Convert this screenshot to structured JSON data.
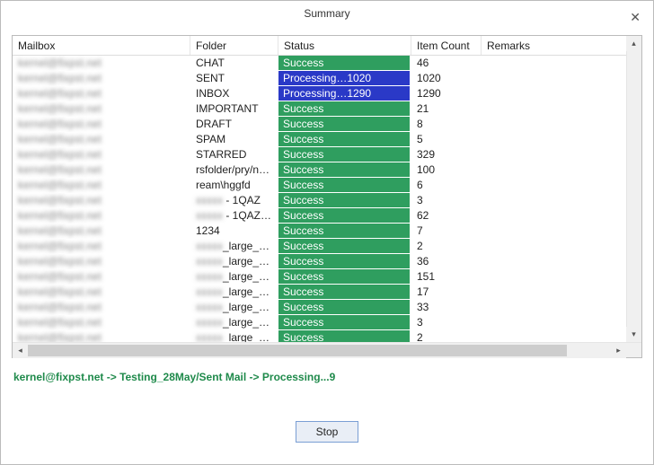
{
  "window": {
    "title": "Summary",
    "close_glyph": "✕"
  },
  "columns": {
    "mailbox": "Mailbox",
    "folder": "Folder",
    "status": "Status",
    "itemCount": "Item Count",
    "remarks": "Remarks"
  },
  "status_labels": {
    "success": "Success",
    "processing": "Processing…"
  },
  "rows": [
    {
      "mailbox": "kernel@fixpst.net",
      "folder": "CHAT",
      "folder_prefix_blur": false,
      "status": "success",
      "status_extra": "",
      "count": "46",
      "remarks": ""
    },
    {
      "mailbox": "kernel@fixpst.net",
      "folder": "SENT",
      "folder_prefix_blur": false,
      "status": "processing",
      "status_extra": "1020",
      "count": "1020",
      "remarks": ""
    },
    {
      "mailbox": "kernel@fixpst.net",
      "folder": "INBOX",
      "folder_prefix_blur": false,
      "status": "processing",
      "status_extra": "1290",
      "count": "1290",
      "remarks": ""
    },
    {
      "mailbox": "kernel@fixpst.net",
      "folder": "IMPORTANT",
      "folder_prefix_blur": false,
      "status": "success",
      "status_extra": "",
      "count": "21",
      "remarks": ""
    },
    {
      "mailbox": "kernel@fixpst.net",
      "folder": "DRAFT",
      "folder_prefix_blur": false,
      "status": "success",
      "status_extra": "",
      "count": "8",
      "remarks": ""
    },
    {
      "mailbox": "kernel@fixpst.net",
      "folder": "SPAM",
      "folder_prefix_blur": false,
      "status": "success",
      "status_extra": "",
      "count": "5",
      "remarks": ""
    },
    {
      "mailbox": "kernel@fixpst.net",
      "folder": "STARRED",
      "folder_prefix_blur": false,
      "status": "success",
      "status_extra": "",
      "count": "329",
      "remarks": ""
    },
    {
      "mailbox": "kernel@fixpst.net",
      "folder": "rsfolder/pry/ne…",
      "folder_prefix_blur": false,
      "status": "success",
      "status_extra": "",
      "count": "100",
      "remarks": ""
    },
    {
      "mailbox": "kernel@fixpst.net",
      "folder": "ream\\hggfd",
      "folder_prefix_blur": false,
      "status": "success",
      "status_extra": "",
      "count": "6",
      "remarks": ""
    },
    {
      "mailbox": "kernel@fixpst.net",
      "folder": " - 1QAZ",
      "folder_prefix_blur": true,
      "status": "success",
      "status_extra": "",
      "count": "3",
      "remarks": ""
    },
    {
      "mailbox": "kernel@fixpst.net",
      "folder": " - 1QAZ/I…",
      "folder_prefix_blur": true,
      "status": "success",
      "status_extra": "",
      "count": "62",
      "remarks": ""
    },
    {
      "mailbox": "kernel@fixpst.net",
      "folder": "1234",
      "folder_prefix_blur": false,
      "status": "success",
      "status_extra": "",
      "count": "7",
      "remarks": ""
    },
    {
      "mailbox": "kernel@fixpst.net",
      "folder": "_large_d…",
      "folder_prefix_blur": true,
      "status": "success",
      "status_extra": "",
      "count": "2",
      "remarks": ""
    },
    {
      "mailbox": "kernel@fixpst.net",
      "folder": "_large_d…",
      "folder_prefix_blur": true,
      "status": "success",
      "status_extra": "",
      "count": "36",
      "remarks": ""
    },
    {
      "mailbox": "kernel@fixpst.net",
      "folder": "_large_d…",
      "folder_prefix_blur": true,
      "status": "success",
      "status_extra": "",
      "count": "151",
      "remarks": ""
    },
    {
      "mailbox": "kernel@fixpst.net",
      "folder": "_large_d…",
      "folder_prefix_blur": true,
      "status": "success",
      "status_extra": "",
      "count": "17",
      "remarks": ""
    },
    {
      "mailbox": "kernel@fixpst.net",
      "folder": "_large_d…",
      "folder_prefix_blur": true,
      "status": "success",
      "status_extra": "",
      "count": "33",
      "remarks": ""
    },
    {
      "mailbox": "kernel@fixpst.net",
      "folder": "_large_d…",
      "folder_prefix_blur": true,
      "status": "success",
      "status_extra": "",
      "count": "3",
      "remarks": ""
    },
    {
      "mailbox": "kernel@fixpst.net",
      "folder": "_large_d…",
      "folder_prefix_blur": true,
      "status": "success",
      "status_extra": "",
      "count": "2",
      "remarks": ""
    }
  ],
  "status_line": "kernel@fixpst.net -> Testing_28May/Sent Mail -> Processing...9",
  "buttons": {
    "stop": "Stop"
  },
  "scroll": {
    "up": "▴",
    "down": "▾",
    "left": "◂",
    "right": "▸"
  }
}
